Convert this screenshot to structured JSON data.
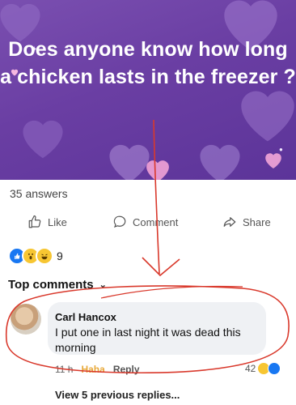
{
  "post": {
    "question": "Does anyone know how long a chicken lasts in the freezer ?",
    "answers_count": "35 answers"
  },
  "actions": {
    "like_label": "Like",
    "comment_label": "Comment",
    "share_label": "Share"
  },
  "reactions": {
    "count": "9",
    "types": [
      "like-icon",
      "wow-icon",
      "haha-icon"
    ]
  },
  "comments": {
    "sort_label": "Top comments",
    "top": {
      "author": "Carl Hancox",
      "text": "I put one in last night it was dead this morning",
      "time": "11 h",
      "reaction_label": "Haha",
      "reply_label": "Reply",
      "reaction_count": "42"
    },
    "view_previous": "View 5 previous replies..."
  },
  "colors": {
    "banner": "#6a3ea3",
    "accent_blue": "#1877f2",
    "haha": "#e8a93a",
    "annotation_red": "#d9392c"
  }
}
